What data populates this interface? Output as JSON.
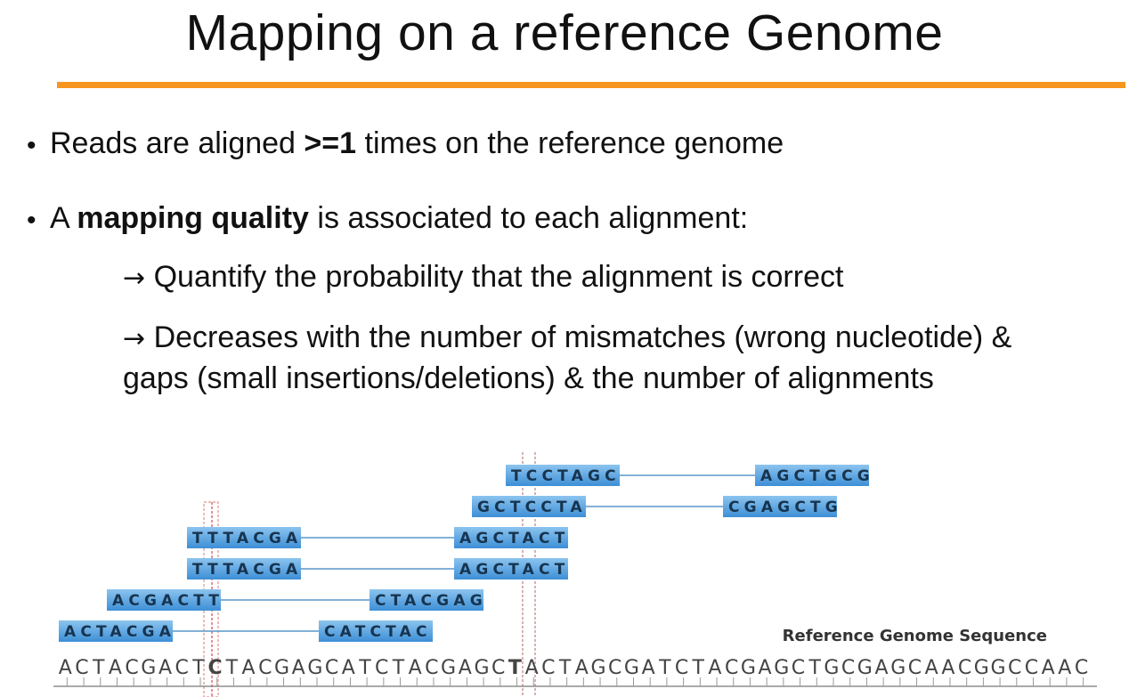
{
  "title": "Mapping on a reference Genome",
  "bullets": {
    "b1": {
      "marker": "•",
      "text_a": "Reads are aligned ",
      "bold": ">=1",
      "text_b": " times on the reference genome"
    },
    "b2": {
      "marker": "•",
      "text_a": "A ",
      "bold": "mapping quality",
      "text_b": " is associated to each alignment:"
    },
    "sub1": {
      "arrow": "→",
      "text": " Quantify  the probability that the alignment is correct"
    },
    "sub2": {
      "arrow": "→",
      "text": " Decreases with the number of mismatches (wrong nucleotide)  &",
      "text2": "gaps (small insertions/deletions) & the number of alignments"
    }
  },
  "diagram": {
    "reference_label": "Reference Genome Sequence",
    "reference_sequence": "ACTACGACTCTACGAGCATCTACGAGCTACTAGCGATCTACGAGCTGCGAGCAACGGCCAAC",
    "mismatch_positions": [
      9,
      27
    ],
    "reads": [
      {
        "left": "TCCTAGC",
        "right": "AGCTGCG"
      },
      {
        "left": "GCTCCTA",
        "right": "CGAGCTG"
      },
      {
        "left": "TTTACGA",
        "right": "AGCTACT"
      },
      {
        "left": "TTTACGA",
        "right": "AGCTACT"
      },
      {
        "left": "ACGACTT",
        "right": "CTACGAG"
      },
      {
        "left": "ACTACGA",
        "right": "CATCTAC"
      }
    ],
    "colors": {
      "read_fill": "#3d8fd6",
      "read_fill_light": "#8cc4ef",
      "link": "#5a97cc",
      "mismatch": "#d62020",
      "highlight_box": "#e0908e"
    }
  }
}
